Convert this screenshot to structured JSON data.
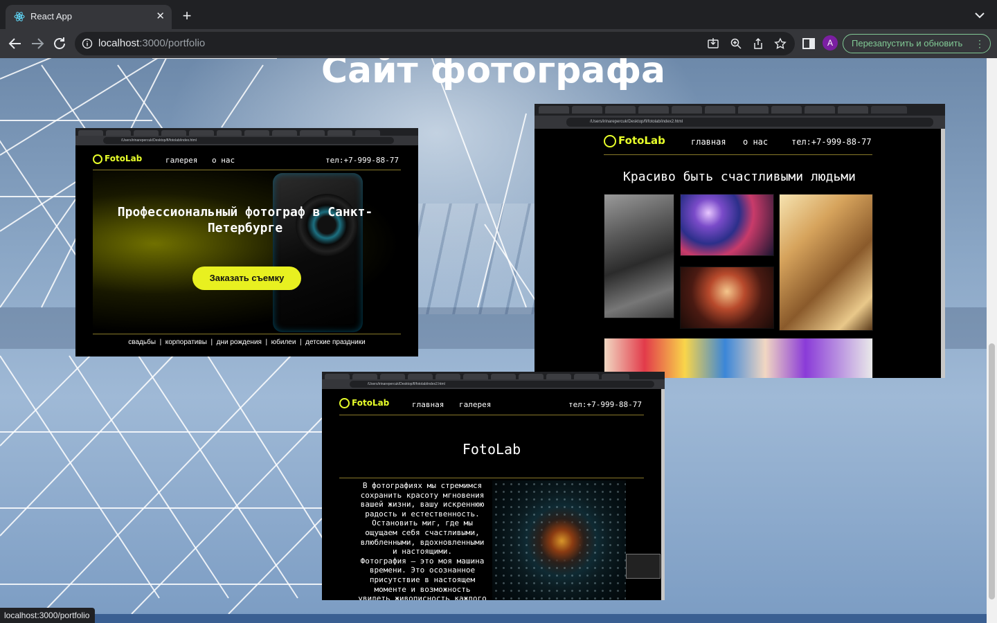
{
  "browser": {
    "tab_title": "React App",
    "url_host": "localhost",
    "url_path": ":3000/portfolio",
    "profile_initial": "A",
    "relaunch_label": "Перезапустить и обновить",
    "status_url": "localhost:3000/portfolio"
  },
  "page": {
    "title": "Сайт фотографа"
  },
  "shot1": {
    "url": "/Users/irinarepercuk/Desktop/fl/fotolab/index.html",
    "logo": "FotoLab",
    "nav": [
      "галерея",
      "о нас"
    ],
    "phone": "тел:+7-999-88-77",
    "hero": "Профессиональный фотограф в Санкт-Петербурге",
    "cta": "Заказать съемку",
    "footer": "свадьбы  |  корпоративы  |  дни рождения  |  юбилеи  |  детские праздники"
  },
  "shot2": {
    "url": "/Users/irinarepercuk/Desktop/fl/fotolab/index2.html",
    "logo": "FotoLab",
    "nav": [
      "главная",
      "о нас"
    ],
    "phone": "тел:+7-999-88-77",
    "title": "Красиво быть счастливыми людьми"
  },
  "shot3": {
    "url": "/Users/irinarepercuk/Desktop/fl/fotolab/index2.html",
    "logo": "FotoLab",
    "nav": [
      "главная",
      "галерея"
    ],
    "phone": "тел:+7-999-88-77",
    "title": "FotoLab",
    "text": "В фотографиях мы стремимся\nсохранить красоту мгновения\nвашей жизни, вашу искреннюю\nрадость и естественность.\nОстановить миг, где мы\nощущаем себя счастливыми,\nвлюбленными, вдохновленными\nи настоящими.\nФотография – это моя машина\nвремени. Это осознанное\nприсутствие в настоящем\nмоменте и возможность\nувидеть живописность каждого"
  },
  "colors": {
    "accent_yellow": "#e8f020",
    "chrome_dark": "#202124",
    "relaunch_green": "#81c995"
  },
  "icons": [
    "react-icon",
    "back-icon",
    "forward-icon",
    "reload-icon",
    "info-icon",
    "install-icon",
    "zoom-icon",
    "share-icon",
    "star-icon",
    "side-panel-icon",
    "more-icon",
    "chevron-down-icon"
  ]
}
